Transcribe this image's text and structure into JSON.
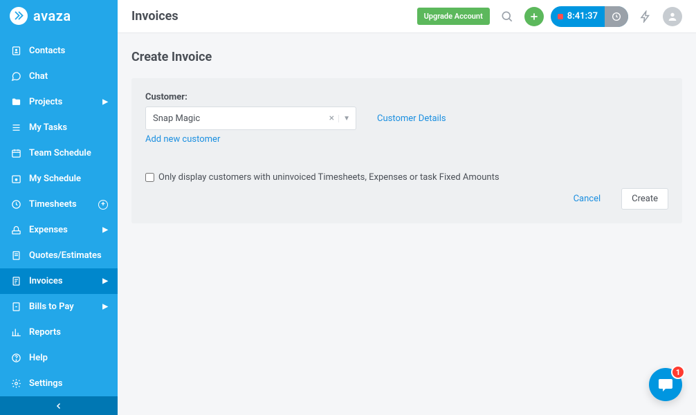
{
  "brand": "avaza",
  "sidebar": {
    "items": [
      {
        "label": "Contacts"
      },
      {
        "label": "Chat"
      },
      {
        "label": "Projects"
      },
      {
        "label": "My Tasks"
      },
      {
        "label": "Team Schedule"
      },
      {
        "label": "My Schedule"
      },
      {
        "label": "Timesheets"
      },
      {
        "label": "Expenses"
      },
      {
        "label": "Quotes/Estimates"
      },
      {
        "label": "Invoices"
      },
      {
        "label": "Bills to Pay"
      },
      {
        "label": "Reports"
      },
      {
        "label": "Help"
      },
      {
        "label": "Settings"
      }
    ]
  },
  "header": {
    "title": "Invoices",
    "upgrade": "Upgrade Account",
    "timer": "8:41:37"
  },
  "page": {
    "title": "Create Invoice",
    "customer_label": "Customer:",
    "customer_value": "Snap Magic",
    "customer_details_link": "Customer Details",
    "add_customer_link": "Add new customer",
    "filter_checkbox_label": "Only display customers with uninvoiced Timesheets, Expenses or task Fixed Amounts",
    "cancel": "Cancel",
    "create": "Create"
  },
  "chat_badge": "1"
}
